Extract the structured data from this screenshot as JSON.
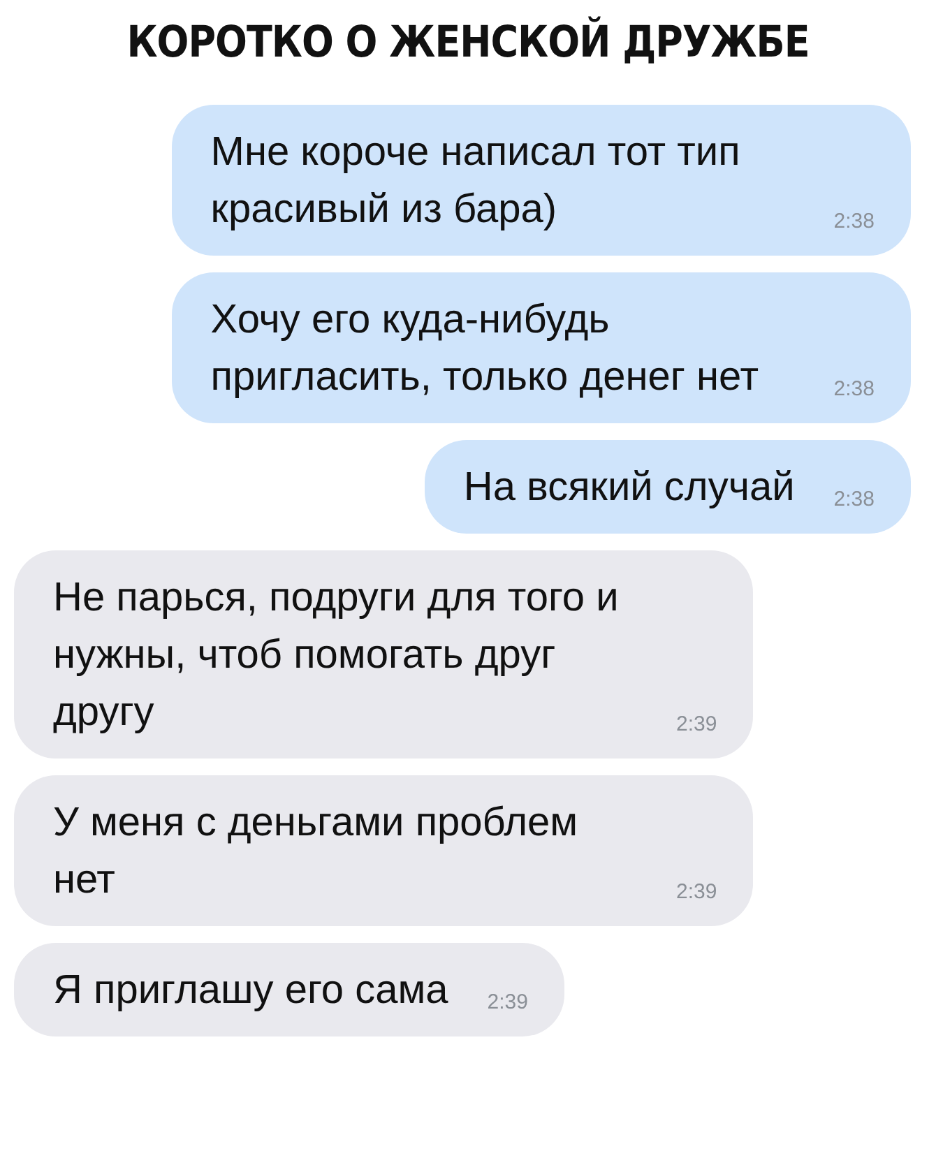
{
  "title": "КОРОТКО О ЖЕНСКОЙ ДРУЖБЕ",
  "messages": [
    {
      "kind": "outgoing",
      "text": "Мне короче написал тот тип красивый из бара)",
      "time": "2:38"
    },
    {
      "kind": "outgoing",
      "text": "Хочу его куда-нибудь пригласить, только денег нет",
      "time": "2:38"
    },
    {
      "kind": "outgoing",
      "text": "На всякий случай",
      "time": "2:38"
    },
    {
      "kind": "incoming",
      "text": "Не парься, подруги для того и нужны, чтоб помогать друг другу",
      "time": "2:39"
    },
    {
      "kind": "incoming",
      "text": "У меня с деньгами проблем нет",
      "time": "2:39"
    },
    {
      "kind": "incoming",
      "text": "Я приглашу его сама",
      "time": "2:39"
    }
  ]
}
